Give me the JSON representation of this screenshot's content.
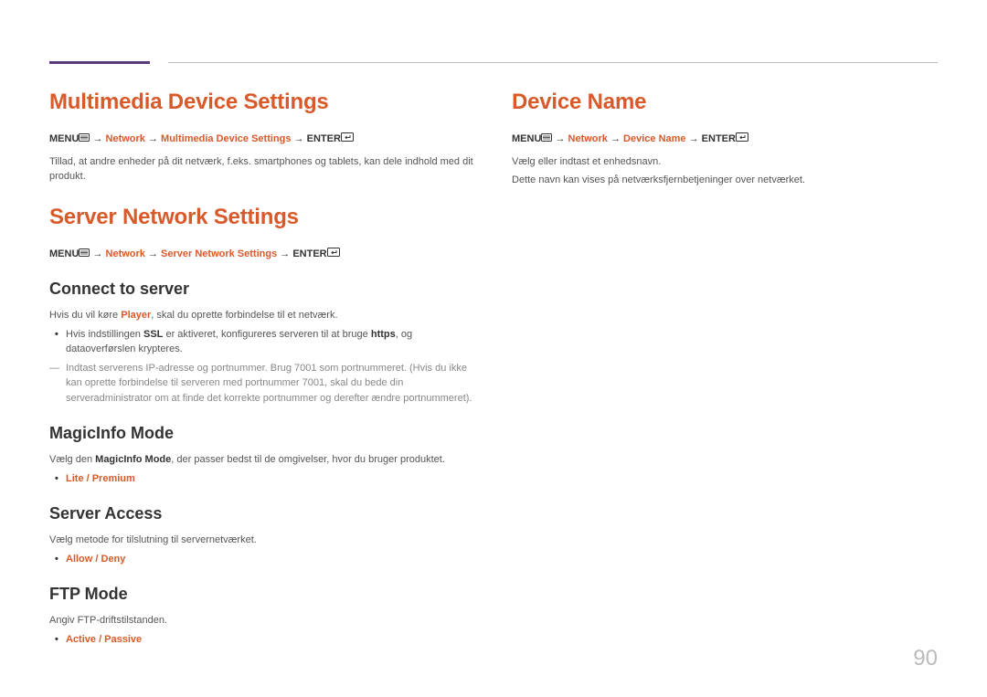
{
  "pageNumber": "90",
  "icons": {
    "menu": "▭",
    "enter": "↵"
  },
  "left": {
    "h1a": "Multimedia Device Settings",
    "path1_pre": "MENU",
    "path1_arrow": " → ",
    "path1_hl1": "Network",
    "path1_hl2": "Multimedia Device Settings",
    "path1_end": "ENTER",
    "body1": "Tillad, at andre enheder på dit netværk, f.eks. smartphones og tablets, kan dele indhold med dit produkt.",
    "h1b": "Server Network Settings",
    "path2_hl2": "Server Network Settings",
    "h2a": "Connect to server",
    "body2_pre": "Hvis du vil køre ",
    "body2_hl": "Player",
    "body2_post": ", skal du oprette forbindelse til et netværk.",
    "bullet1_pre": "Hvis indstillingen ",
    "bullet1_b1": "SSL",
    "bullet1_mid": " er aktiveret, konfigureres serveren til at bruge ",
    "bullet1_b2": "https",
    "bullet1_post": ", og dataoverførslen krypteres.",
    "note1": "Indtast serverens IP-adresse og portnummer. Brug 7001 som portnummeret. (Hvis du ikke kan oprette forbindelse til serveren med portnummer 7001, skal du bede din serveradministrator om at finde det korrekte portnummer og derefter ændre portnummeret).",
    "h2b": "MagicInfo Mode",
    "body3_pre": "Vælg den ",
    "body3_b": "MagicInfo Mode",
    "body3_post": ", der passer bedst til de omgivelser, hvor du bruger produktet.",
    "bullet2": "Lite / Premium",
    "h2c": "Server Access",
    "body4": "Vælg metode for tilslutning til servernetværket.",
    "bullet3": "Allow / Deny",
    "h2d": "FTP Mode",
    "body5": "Angiv FTP-driftstilstanden.",
    "bullet4": "Active / Passive"
  },
  "right": {
    "h1": "Device Name",
    "path_hl2": "Device Name",
    "body1": "Vælg eller indtast et enhedsnavn.",
    "body2": "Dette navn kan vises på netværksfjernbetjeninger over netværket."
  }
}
